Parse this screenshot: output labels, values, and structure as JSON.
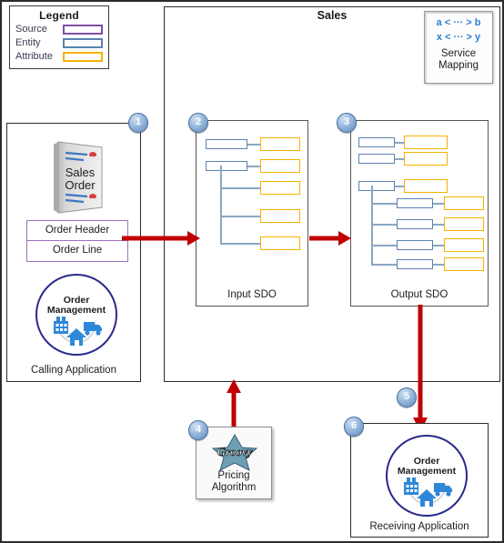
{
  "legend": {
    "title": "Legend",
    "items": [
      {
        "label": "Source",
        "color": "#7b4fa5"
      },
      {
        "label": "Entity",
        "color": "#5b82b0"
      },
      {
        "label": "Attribute",
        "color": "#f5b301"
      }
    ]
  },
  "sales": {
    "title": "Sales"
  },
  "service_mapping": {
    "line1": "a < ··· > b",
    "line2": "x < ··· > y",
    "label_line1": "Service",
    "label_line2": "Mapping"
  },
  "calling_application": {
    "caption": "Calling Application",
    "doc_icon_line1": "Sales",
    "doc_icon_line2": "Order",
    "source_rows": [
      "Order Header",
      "Order Line"
    ],
    "logo_line1": "Order",
    "logo_line2": "Management"
  },
  "input_sdo": {
    "caption": "Input SDO"
  },
  "output_sdo": {
    "caption": "Output SDO"
  },
  "pricing": {
    "logo_text": "Groovy",
    "label_line1": "Pricing",
    "label_line2": "Algorithm"
  },
  "receiving_application": {
    "caption": "Receiving  Application",
    "logo_line1": "Order",
    "logo_line2": "Management"
  },
  "steps": [
    {
      "id": "1",
      "number": "1"
    },
    {
      "id": "2",
      "number": "2"
    },
    {
      "id": "3",
      "number": "3"
    },
    {
      "id": "4",
      "number": "4"
    },
    {
      "id": "5",
      "number": "5"
    },
    {
      "id": "6",
      "number": "6"
    }
  ],
  "colors": {
    "source": "#7b4fa5",
    "entity": "#5b82b0",
    "attribute": "#f5b301",
    "arrow": "#c00000",
    "marker": "#5d88bb",
    "accent_blue": "#2b7fd4"
  }
}
